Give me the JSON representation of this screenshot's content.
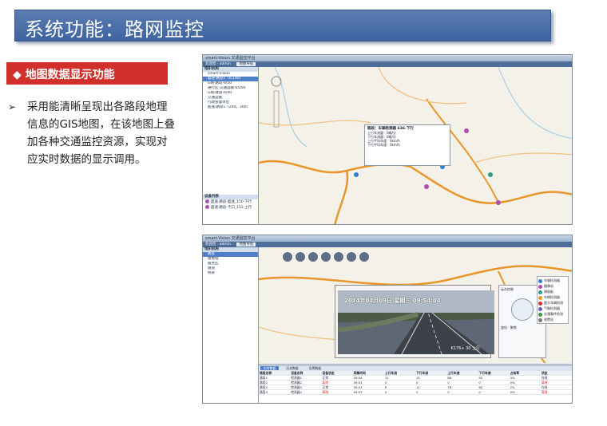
{
  "slide": {
    "title": "系统功能：路网监控",
    "section_tag": "◆ 地图数据显示功能",
    "bullet": "采用能清晰呈现出各路段地理信息的GIS地图，在该地图上叠加各种交通监控资源，实现对应实时数据的显示调用。"
  },
  "screenshot1": {
    "tree_root": "smart-Vision",
    "tree_items": [
      "超速·路段1（0,140）",
      "G网·路段-6/50",
      "通行区·交通运输-6/200",
      "G网·隧道-6/40",
      "交通运输",
      "行政管理单位",
      "超速·路段1（200，300）"
    ],
    "devices": [
      "超速·路段·超速_150·下行",
      "超速·路段·卡口_152·上行"
    ],
    "popup_title": "路段：车辆检测器 636-下行",
    "popup_rows": [
      "上行车流量：0辆/分",
      "下行车流量：0辆/分",
      "上行平均车速：0km/h",
      "下行平均车速：0km/h"
    ]
  },
  "screenshot2": {
    "timestamp": "2014年04月09日 星期三 09:54:04",
    "video_overlay": "K176+ 30 上行",
    "legend": [
      "车辆检测器",
      "摄像机",
      "情报板",
      "车辆检测器",
      "超大车辆检测",
      "气象检测器",
      "交通事件检测",
      "收费站"
    ],
    "grid_tabs": [
      "实时数据",
      "历史数据",
      "告警数据"
    ],
    "grid_headers": [
      "路段名称",
      "设备名称",
      "设备状态",
      "采集时间",
      "上行车流",
      "下行车流",
      "上行车速",
      "下行车速",
      "占有率",
      "状态"
    ],
    "grid_rows": [
      [
        "路段1",
        "检测器1",
        "正常",
        "09:54",
        "12",
        "15",
        "86",
        "92",
        "3%",
        "在线"
      ],
      [
        "路段2",
        "检测器2",
        "离线",
        "09:54",
        "0",
        "0",
        "0",
        "0",
        "0%",
        "离线"
      ],
      [
        "路段3",
        "检测器3",
        "正常",
        "09:53",
        "8",
        "11",
        "78",
        "80",
        "2%",
        "在线"
      ],
      [
        "路段4",
        "检测器4",
        "离线",
        "09:53",
        "0",
        "0",
        "0",
        "0",
        "0%",
        "离线"
      ]
    ]
  }
}
